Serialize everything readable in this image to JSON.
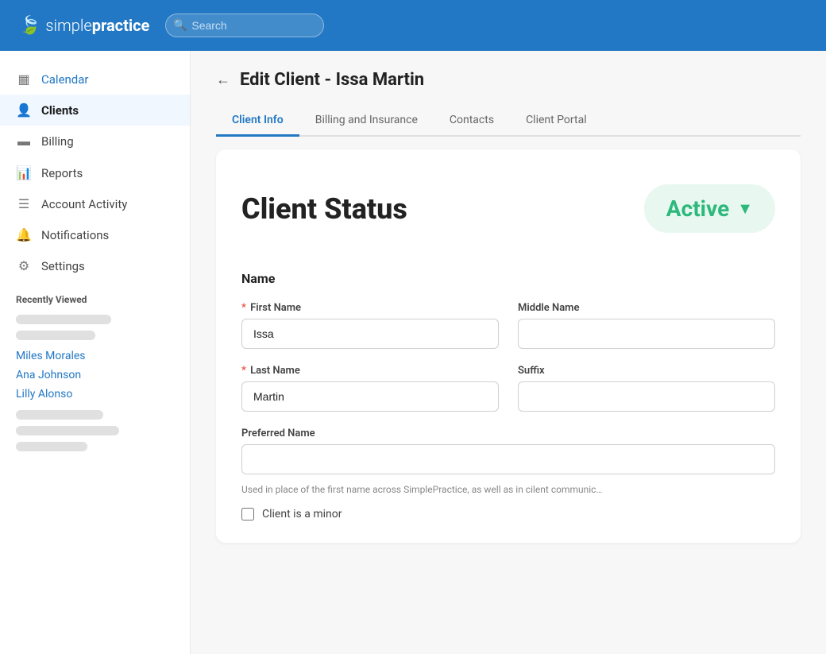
{
  "app": {
    "logo_simple": "simple",
    "logo_practice": "practice",
    "logo_icon": "🍃"
  },
  "topnav": {
    "search_placeholder": "Search"
  },
  "sidebar": {
    "nav_items": [
      {
        "id": "calendar",
        "label": "Calendar",
        "icon": "▦",
        "active": false,
        "colored": true
      },
      {
        "id": "clients",
        "label": "Clients",
        "icon": "👤",
        "active": true,
        "colored": false
      },
      {
        "id": "billing",
        "label": "Billing",
        "icon": "▬",
        "active": false,
        "colored": false
      },
      {
        "id": "reports",
        "label": "Reports",
        "icon": "📊",
        "active": false,
        "colored": false
      },
      {
        "id": "account-activity",
        "label": "Account Activity",
        "icon": "☰",
        "active": false,
        "colored": false
      },
      {
        "id": "notifications",
        "label": "Notifications",
        "icon": "🔔",
        "active": false,
        "colored": false
      },
      {
        "id": "settings",
        "label": "Settings",
        "icon": "⚙",
        "active": false,
        "colored": false
      }
    ],
    "recently_viewed_title": "Recently Viewed",
    "recent_links": [
      {
        "id": "miles-morales",
        "label": "Miles Morales"
      },
      {
        "id": "ana-johnson",
        "label": "Ana Johnson"
      },
      {
        "id": "lilly-alonso",
        "label": "Lilly Alonso"
      }
    ]
  },
  "page": {
    "back_label": "←",
    "title": "Edit Client -  Issa Martin"
  },
  "tabs": [
    {
      "id": "client-info",
      "label": "Client Info",
      "active": true
    },
    {
      "id": "billing-insurance",
      "label": "Billing and Insurance",
      "active": false
    },
    {
      "id": "contacts",
      "label": "Contacts",
      "active": false
    },
    {
      "id": "client-portal",
      "label": "Client Portal",
      "active": false
    }
  ],
  "client_status": {
    "section_label": "Client Status",
    "status_value": "Active"
  },
  "name_section": {
    "title": "Name",
    "first_name_label": "First Name",
    "first_name_value": "Issa",
    "first_name_required": true,
    "middle_name_label": "Middle Name",
    "middle_name_value": "",
    "last_name_label": "Last Name",
    "last_name_value": "Martin",
    "last_name_required": true,
    "suffix_label": "Suffix",
    "suffix_value": "",
    "preferred_name_label": "Preferred Name",
    "preferred_name_value": "",
    "preferred_name_hint": "Used in place of the first name across SimplePractice, as well as in cilent communic…",
    "client_is_minor_label": "Client is a minor"
  }
}
